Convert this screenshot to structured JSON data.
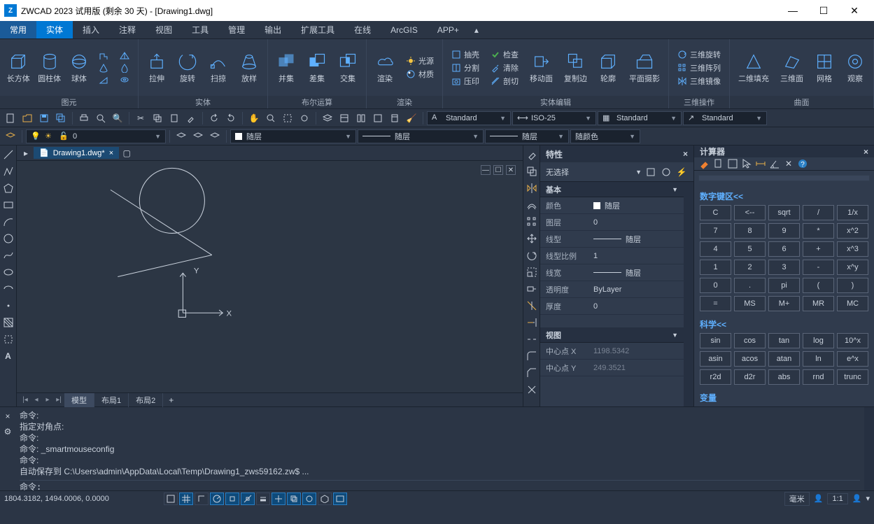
{
  "title": "ZWCAD 2023 试用版 (剩余 30 天) - [Drawing1.dwg]",
  "menu": {
    "items": [
      "常用",
      "实体",
      "插入",
      "注释",
      "视图",
      "工具",
      "管理",
      "输出",
      "扩展工具",
      "在线",
      "ArcGIS",
      "APP+"
    ],
    "activeIndex": 1
  },
  "ribbon": {
    "groups": [
      {
        "label": "图元",
        "buttons": [
          "长方体",
          "圆柱体",
          "球体"
        ],
        "extras": [
          "poly-icon",
          "cone-icon",
          "drop-icon",
          "torus-icon"
        ]
      },
      {
        "label": "实体",
        "buttons": [
          "拉伸",
          "旋转",
          "扫掠",
          "放样"
        ]
      },
      {
        "label": "布尔运算",
        "buttons": [
          "并集",
          "差集",
          "交集"
        ]
      },
      {
        "label": "渲染",
        "buttons": [
          "渲染"
        ],
        "stack": [
          "光源",
          "材质"
        ]
      },
      {
        "label": "实体编辑",
        "stacks": [
          [
            "抽壳",
            "分割",
            "压印"
          ],
          [
            "检查",
            "清除",
            "剖切"
          ]
        ],
        "buttons": [
          "移动面",
          "复制边",
          "轮廓",
          "平面摄影"
        ]
      },
      {
        "label": "三维操作",
        "stack": [
          "三维旋转",
          "三维阵列",
          "三维镜像"
        ]
      },
      {
        "label": "曲面",
        "buttons": [
          "二维填充",
          "三维面",
          "网格",
          "观察"
        ]
      }
    ]
  },
  "combo_row1": {
    "textstyle": "Standard",
    "dimstyle": "ISO-25",
    "tablestyle": "Standard",
    "mleaderstyle": "Standard"
  },
  "combo_row2": {
    "layer": "0",
    "color": "随层",
    "linetype": "随层",
    "lineweight": "随层",
    "plotstyle": "随颜色"
  },
  "doc": {
    "tab": "Drawing1.dwg*"
  },
  "layouts": {
    "items": [
      "模型",
      "布局1",
      "布局2"
    ],
    "active": 0
  },
  "properties": {
    "title": "特性",
    "selection": "无选择",
    "groups": [
      {
        "name": "基本",
        "rows": [
          {
            "k": "颜色",
            "v": "随层",
            "swatch": true
          },
          {
            "k": "图层",
            "v": "0"
          },
          {
            "k": "线型",
            "v": "随层",
            "line": true
          },
          {
            "k": "线型比例",
            "v": "1"
          },
          {
            "k": "线宽",
            "v": "随层",
            "line": true
          },
          {
            "k": "透明度",
            "v": "ByLayer"
          },
          {
            "k": "厚度",
            "v": "0"
          }
        ]
      },
      {
        "name": "视图",
        "rows": [
          {
            "k": "中心点 X",
            "v": "1198.5342"
          },
          {
            "k": "中心点 Y",
            "v": "249.3521"
          }
        ]
      }
    ]
  },
  "calculator": {
    "title": "计算器",
    "sec_num": "数字键区<<",
    "sec_sci": "科学<<",
    "sec_var": "变量",
    "numkeys": [
      [
        "C",
        "<--",
        "sqrt",
        "/",
        "1/x"
      ],
      [
        "7",
        "8",
        "9",
        "*",
        "x^2"
      ],
      [
        "4",
        "5",
        "6",
        "+",
        "x^3"
      ],
      [
        "1",
        "2",
        "3",
        "-",
        "x^y"
      ],
      [
        "0",
        ".",
        "pi",
        "(",
        ")"
      ],
      [
        "=",
        "MS",
        "M+",
        "MR",
        "MC"
      ]
    ],
    "scikeys": [
      [
        "sin",
        "cos",
        "tan",
        "log",
        "10^x"
      ],
      [
        "asin",
        "acos",
        "atan",
        "ln",
        "e^x"
      ],
      [
        "r2d",
        "d2r",
        "abs",
        "rnd",
        "trunc"
      ]
    ]
  },
  "command": {
    "history": "命令:\n指定对角点:\n命令:\n命令: _smartmouseconfig\n命令:\n自动保存到 C:\\Users\\admin\\AppData\\Local\\Temp\\Drawing1_zws59162.zw$ ...",
    "prompt": "命令:"
  },
  "status": {
    "coords": "1804.3182, 1494.0006, 0.0000",
    "unit": "毫米",
    "ratio": "1:1"
  },
  "axis": {
    "x": "X",
    "y": "Y"
  }
}
